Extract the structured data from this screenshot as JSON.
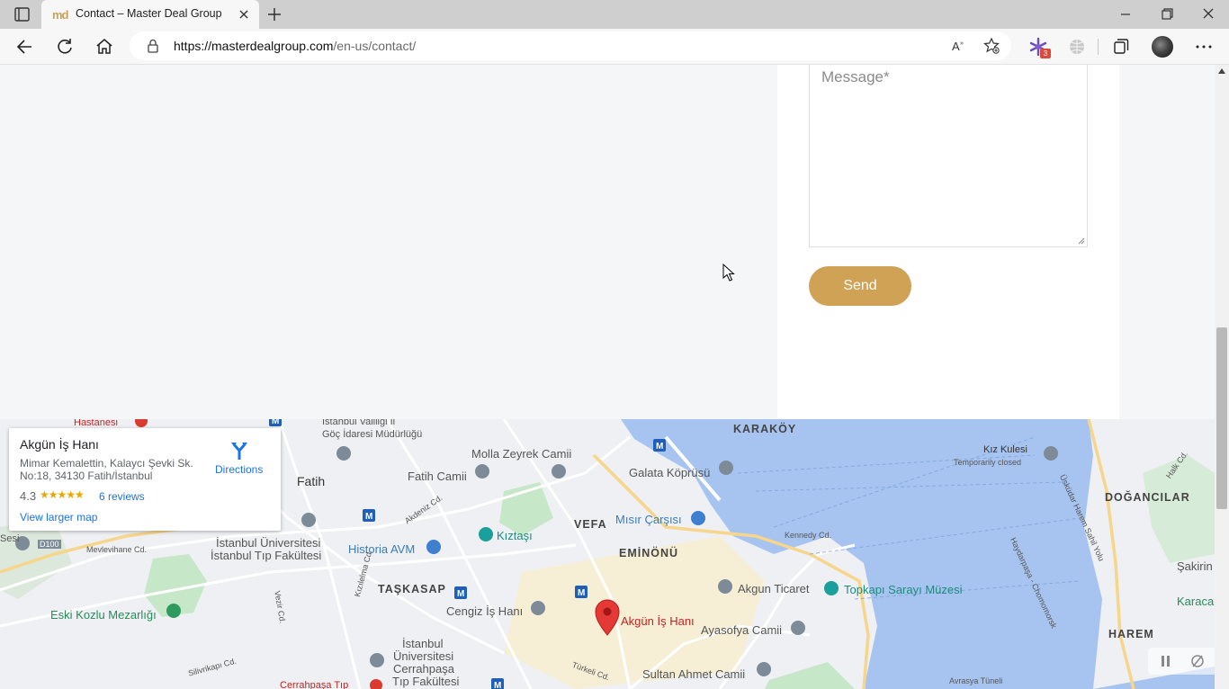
{
  "browser": {
    "tab": {
      "favicon": "md",
      "title": "Contact – Master Deal Group"
    },
    "address": {
      "domain": "https://masterdealgroup.com",
      "path": "/en-us/contact/"
    },
    "extension_badge": "3",
    "icons": [
      "tab-actions-icon",
      "close-icon",
      "plus-icon",
      "minimize-icon",
      "restore-icon",
      "window-close-icon",
      "back-icon",
      "refresh-icon",
      "home-icon",
      "lock-icon",
      "read-aloud-icon",
      "favorites-icon",
      "extension-icon",
      "globe-icon",
      "collections-icon",
      "more-icon"
    ]
  },
  "form": {
    "message_placeholder": "Message*",
    "send_label": "Send"
  },
  "map": {
    "card": {
      "name": "Akgün İş Hanı",
      "address_line1": "Mimar Kemalettin, Kalaycı Şevki Sk.",
      "address_line2": "No:18, 34130 Fatih/İstanbul",
      "rating": "4.3",
      "stars": "★★★★★",
      "reviews": "6 reviews",
      "view_larger": "View larger map",
      "directions": "Directions"
    },
    "labels": {
      "hastanesi": "Hastanesi",
      "valilik1": "İstanbul Valiliği İl",
      "valilik2": "Göç İdaresi Müdürlüğü",
      "karakoy": "KARAKÖY",
      "kiz_kulesi": "Kız Kulesi",
      "temp_closed": "Temporarily closed",
      "fatih": "Fatih",
      "molla": "Molla Zeyrek Camii",
      "fatih_camii": "Fatih Camii",
      "galata": "Galata Köprüsü",
      "uskudar": "Üsküdar Harem Sahil Yolu",
      "halk": "Halk Cd.",
      "dogancilar": "DOĞANCILAR",
      "d100": "D100",
      "mevlevihane": "Mevlevihane Cd.",
      "akdeniz": "Akdeniz Cd.",
      "kiztasi": "Kıztaşı",
      "vefa": "VEFA",
      "misir": "Mısır Çarşısı",
      "kennedy": "Kennedy Cd.",
      "uni1": "İstanbul Üniversitesi",
      "uni2": "İstanbul Tıp Fakültesi",
      "historia": "Historia AVM",
      "eminonu": "EMİNÖNÜ",
      "haydarpasa": "Haydarpaşa - Chomomorsk",
      "sakirin": "Şakirin",
      "taskasap": "TAŞKASAP",
      "akgun_ticaret": "Akgun Ticaret",
      "topkapi": "Topkapı Sarayı Müzesi",
      "karaca": "Karaca",
      "eski_kozlu": "Eski Kozlu Mezarlığı",
      "cengiz": "Cengiz İş Hanı",
      "akgun_is_hani": "Akgün İş Hanı",
      "ayasofya": "Ayasofya Camii",
      "harem": "HAREM",
      "vezir": "Vezir Cd.",
      "kizilelma": "Kızılelma Cd.",
      "uni_c1": "İstanbul",
      "uni_c2": "Üniversitesi",
      "uni_c3": "Cerrahpaşa",
      "uni_c4": "Tıp Fakültesi",
      "silivrikapi": "Silivrikapı Cd.",
      "turkeli": "Türkeli Cd.",
      "sultan_ahmet": "Sultan Ahmet Camii",
      "cerrahpasa_tip": "Cerrahpaşa Tıp",
      "avrasya": "Avrasya Tüneli",
      "sesi": "Sesi",
      "metro": "M"
    },
    "colors": {
      "water": "#a7c4f0",
      "land": "#eef0f3",
      "park": "#c6e8c9",
      "road": "#ffffff",
      "pin": "#e53935"
    }
  }
}
